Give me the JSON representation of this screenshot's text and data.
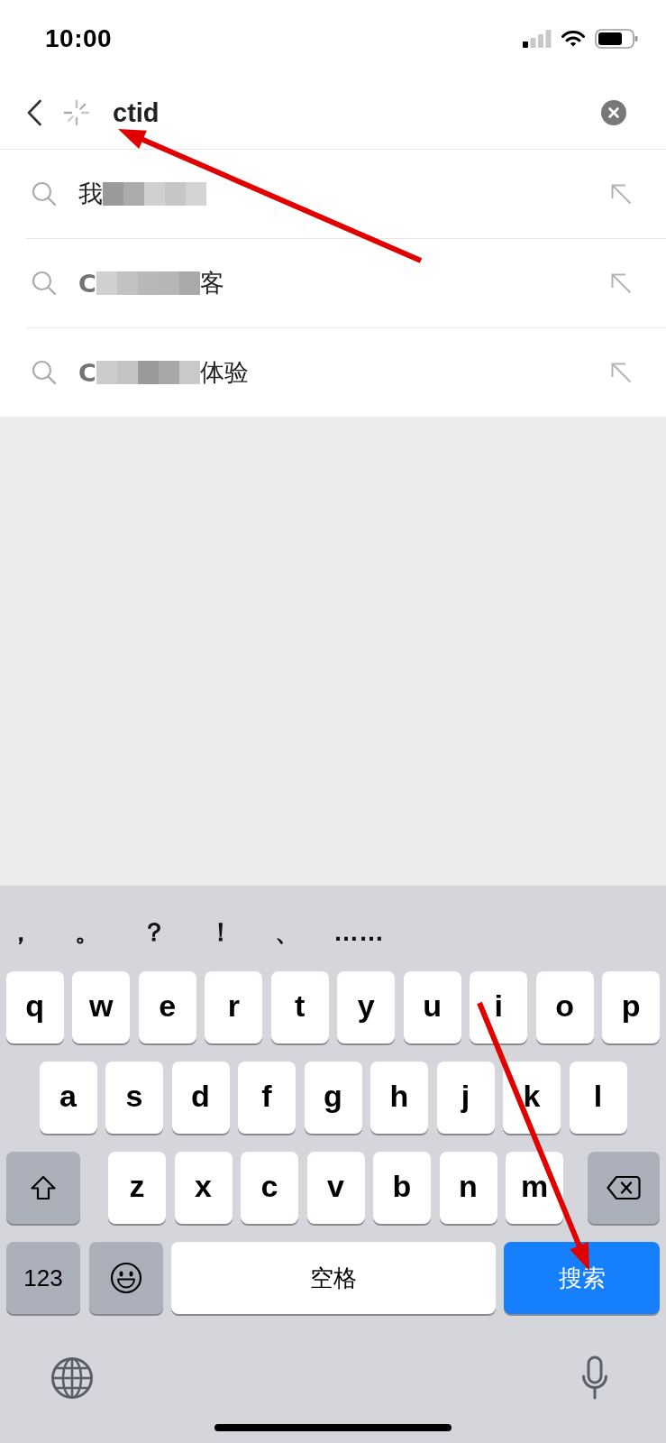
{
  "status_bar": {
    "time": "10:00"
  },
  "search": {
    "loading": true,
    "value": "ctid"
  },
  "suggestions": [
    {
      "lead": "我",
      "matched": false,
      "redacted": true
    },
    {
      "lead": "C",
      "matched": true,
      "redacted": true,
      "tail": "客"
    },
    {
      "lead": "C",
      "matched": true,
      "redacted": true,
      "tail": "体验"
    }
  ],
  "keyboard": {
    "candidates": [
      "，",
      "。",
      "？",
      "！",
      "、",
      "……"
    ],
    "letter_rows": [
      {
        "keys": [
          {
            "kind": "letter",
            "label": "q"
          },
          {
            "kind": "letter",
            "label": "w"
          },
          {
            "kind": "letter",
            "label": "e"
          },
          {
            "kind": "letter",
            "label": "r"
          },
          {
            "kind": "letter",
            "label": "t"
          },
          {
            "kind": "letter",
            "label": "y"
          },
          {
            "kind": "letter",
            "label": "u"
          },
          {
            "kind": "letter",
            "label": "i"
          },
          {
            "kind": "letter",
            "label": "o"
          },
          {
            "kind": "letter",
            "label": "p"
          }
        ]
      },
      {
        "keys": [
          {
            "kind": "letter",
            "label": "a"
          },
          {
            "kind": "letter",
            "label": "s"
          },
          {
            "kind": "letter",
            "label": "d"
          },
          {
            "kind": "letter",
            "label": "f"
          },
          {
            "kind": "letter",
            "label": "g"
          },
          {
            "kind": "letter",
            "label": "h"
          },
          {
            "kind": "letter",
            "label": "j"
          },
          {
            "kind": "letter",
            "label": "k"
          },
          {
            "kind": "letter",
            "label": "l"
          }
        ]
      },
      {
        "keys": [
          {
            "kind": "shift"
          },
          {
            "kind": "letter",
            "label": "z"
          },
          {
            "kind": "letter",
            "label": "x"
          },
          {
            "kind": "letter",
            "label": "c"
          },
          {
            "kind": "letter",
            "label": "v"
          },
          {
            "kind": "letter",
            "label": "b"
          },
          {
            "kind": "letter",
            "label": "n"
          },
          {
            "kind": "letter",
            "label": "m"
          },
          {
            "kind": "backspace"
          }
        ]
      }
    ],
    "bottom_row": {
      "keys": [
        {
          "kind": "numbers",
          "label": "123"
        },
        {
          "kind": "emoji"
        },
        {
          "kind": "space",
          "label": "空格"
        },
        {
          "kind": "action",
          "label": "搜索"
        }
      ]
    }
  },
  "annotations": [
    {
      "kind": "arrow"
    },
    {
      "kind": "arrow"
    }
  ]
}
